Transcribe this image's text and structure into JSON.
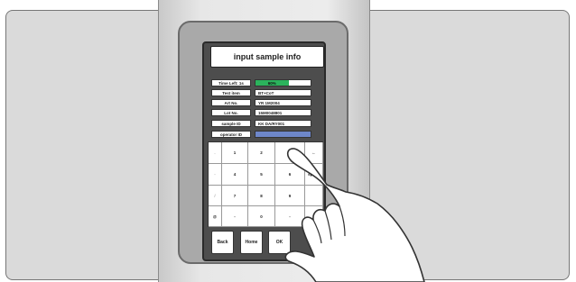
{
  "title": "input sample info",
  "status": {
    "left": "",
    "right": ""
  },
  "fields": [
    {
      "label": "Time Left: 1s",
      "value": "60%",
      "progress": 0.6
    },
    {
      "label": "Test item",
      "value": "BT+CoT"
    },
    {
      "label": "Art No.",
      "value": "YR 1M2004"
    },
    {
      "label": "Lot No.",
      "value": "15M0048801"
    },
    {
      "label": "sample ID",
      "value": "KK DA/RY001"
    },
    {
      "label": "operator ID",
      "value": ""
    }
  ],
  "keypad": {
    "rows": [
      [
        ".",
        "1",
        "2",
        "3",
        "←"
      ],
      [
        "-",
        "4",
        "5",
        "6",
        "space"
      ],
      [
        "/",
        "7",
        "8",
        "9",
        ""
      ],
      [
        "@",
        "-",
        "0",
        "-",
        ""
      ]
    ]
  },
  "buttons": {
    "back": "Back",
    "home": "Home",
    "ok": "OK"
  },
  "colors": {
    "progress_fill": "#2bb35c",
    "active_field": "#6e87c9"
  }
}
